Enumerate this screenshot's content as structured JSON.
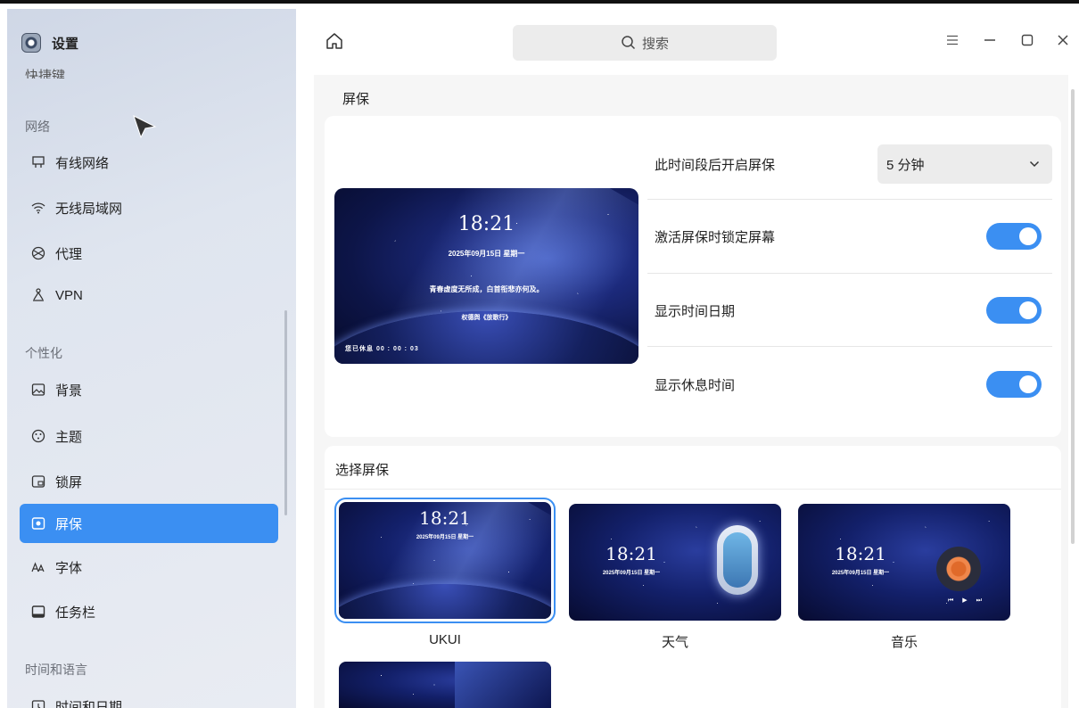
{
  "app": {
    "title": "设置"
  },
  "sidebar": {
    "cut_item": "快捷键",
    "section_network": "网络",
    "section_personalize": "个性化",
    "section_time_lang": "时间和语言",
    "items": [
      {
        "label": "有线网络",
        "icon": "wired-network-icon"
      },
      {
        "label": "无线局域网",
        "icon": "wifi-icon"
      },
      {
        "label": "代理",
        "icon": "proxy-icon"
      },
      {
        "label": "VPN",
        "icon": "vpn-icon"
      },
      {
        "label": "背景",
        "icon": "background-icon"
      },
      {
        "label": "主题",
        "icon": "theme-icon"
      },
      {
        "label": "锁屏",
        "icon": "lockscreen-icon"
      },
      {
        "label": "屏保",
        "icon": "screensaver-icon",
        "active": true
      },
      {
        "label": "字体",
        "icon": "font-icon"
      },
      {
        "label": "任务栏",
        "icon": "taskbar-icon"
      },
      {
        "label": "时间和日期",
        "icon": "datetime-icon"
      }
    ]
  },
  "titlebar": {
    "search_placeholder": "搜索"
  },
  "main": {
    "title": "屏保",
    "preview": {
      "time": "18:21",
      "date": "2025年09月15日 星期一",
      "quote": "青春虚度无所成，白首衔悲亦何及。",
      "author": "权德舆《放歌行》",
      "rest": "您已休息   00  :  00  :  03"
    },
    "settings": {
      "delay_label": "此时间段后开启屏保",
      "delay_value": "5 分钟",
      "lock_label": "激活屏保时锁定屏幕",
      "lock_on": true,
      "show_datetime_label": "显示时间日期",
      "show_datetime_on": true,
      "show_rest_label": "显示休息时间",
      "show_rest_on": true
    },
    "select_title": "选择屏保",
    "thumbnails": [
      {
        "label": "UKUI",
        "time": "18:21",
        "date": "2025年09月15日 星期一",
        "selected": true
      },
      {
        "label": "天气",
        "time": "18:21",
        "date": "2025年09月15日 星期一"
      },
      {
        "label": "音乐",
        "time": "18:21",
        "date": "2025年09月15日 星期一"
      }
    ]
  },
  "colors": {
    "accent": "#3b8ff2",
    "sidebar_bg": "#dde3ee"
  }
}
